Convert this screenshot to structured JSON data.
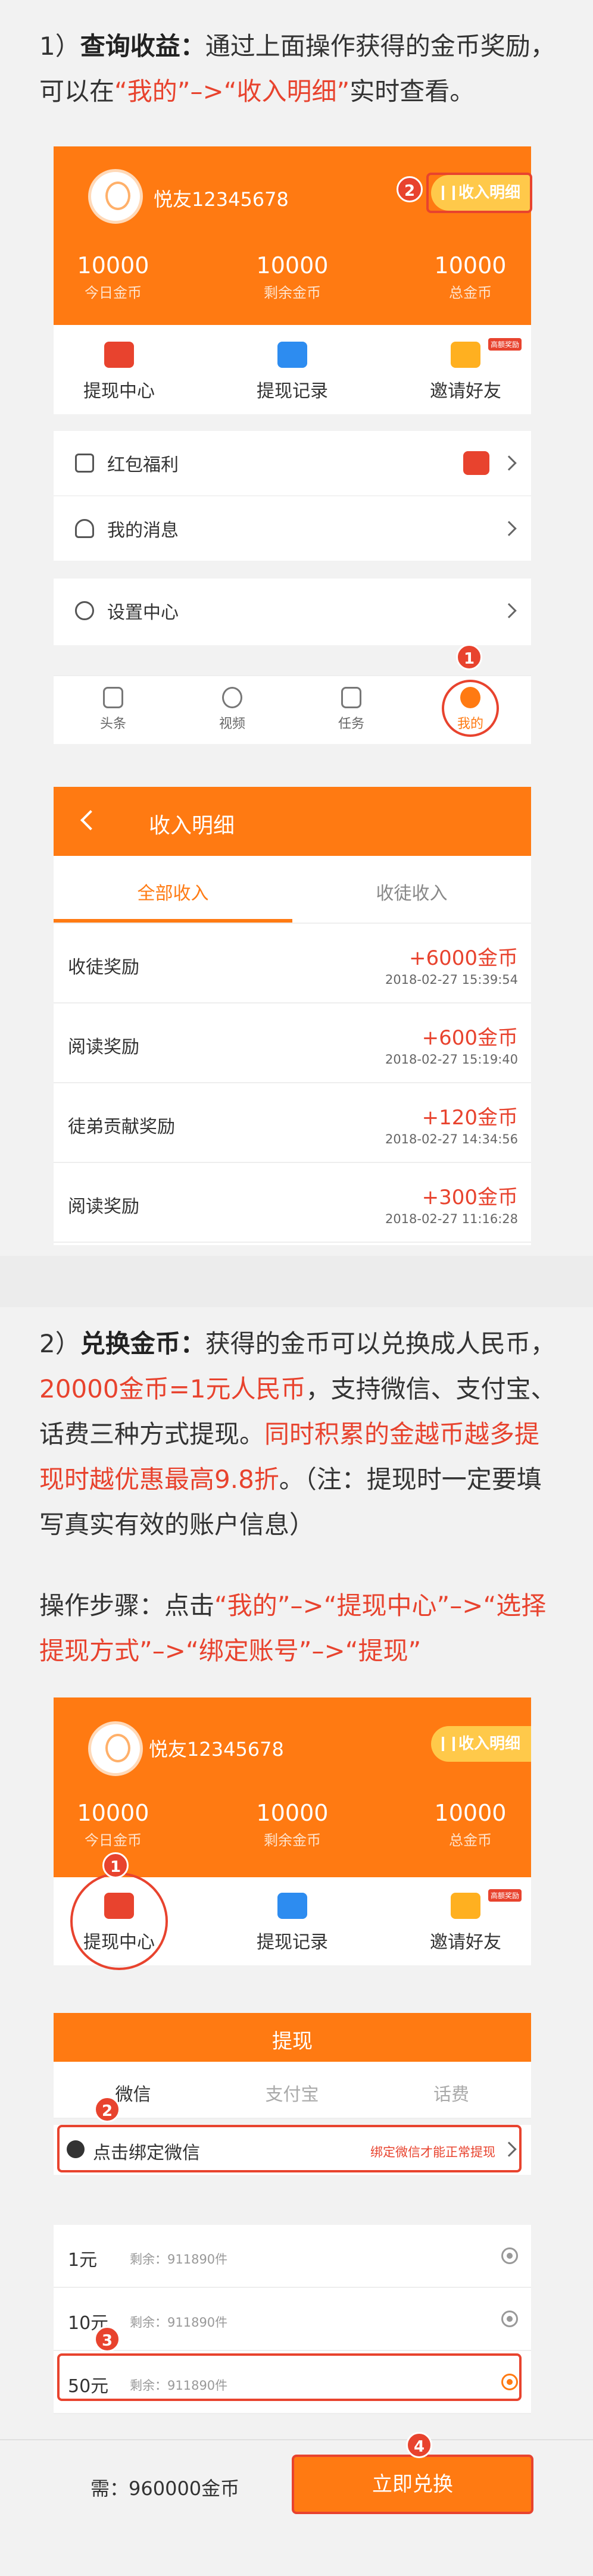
{
  "colors": {
    "accent": "#ff7a12",
    "highlight": "#e8432e",
    "text": "#333333"
  },
  "section1": {
    "index": "1）",
    "title": "查询收益：",
    "text_a": "通过上面操作获得的金币奖励，可以在",
    "link_me": "“我的”",
    "arrow": "–>",
    "link_income": "“收入明细”",
    "text_b": "实时查看。"
  },
  "profile": {
    "username": "悦友12345678",
    "income_button": "收入明细",
    "stats": [
      {
        "value": "10000",
        "label": "今日金币"
      },
      {
        "value": "10000",
        "label": "剩余金币"
      },
      {
        "value": "10000",
        "label": "总金币"
      }
    ],
    "shortcuts": [
      {
        "label": "提现中心",
        "icon": "wallet-icon"
      },
      {
        "label": "提现记录",
        "icon": "record-icon"
      },
      {
        "label": "邀请好友",
        "icon": "gift-icon",
        "tag": "高额奖励"
      }
    ],
    "menu": [
      {
        "label": "红包福利",
        "icon": "redpacket-icon"
      },
      {
        "label": "我的消息",
        "icon": "bell-icon"
      },
      {
        "label": "设置中心",
        "icon": "settings-icon"
      }
    ],
    "tabs": [
      {
        "label": "头条",
        "icon": "news-icon"
      },
      {
        "label": "视频",
        "icon": "video-icon"
      },
      {
        "label": "任务",
        "icon": "task-icon"
      },
      {
        "label": "我的",
        "icon": "me-icon"
      }
    ]
  },
  "steps": {
    "one": "1",
    "two": "2",
    "three": "3",
    "four": "4"
  },
  "income": {
    "title": "收入明细",
    "tab_all": "全部收入",
    "tab_apprentice": "收徒收入",
    "records": [
      {
        "name": "收徒奖励",
        "amount": "+6000金币",
        "time": "2018-02-27 15:39:54"
      },
      {
        "name": "阅读奖励",
        "amount": "+600金币",
        "time": "2018-02-27 15:19:40"
      },
      {
        "name": "徒弟贡献奖励",
        "amount": "+120金币",
        "time": "2018-02-27 14:34:56"
      },
      {
        "name": "阅读奖励",
        "amount": "+300金币",
        "time": "2018-02-27 11:16:28"
      }
    ]
  },
  "section2": {
    "index": "2）",
    "title": "兑换金币：",
    "text_a": "获得的金币可以兑换成人民币，",
    "rate": "20000金币=1元人民币",
    "text_b": "，支持微信、支付宝、话费三种方式提现。",
    "bonus": "同时积累的金越币越多提现时越优惠最高9.8折",
    "text_c": "。（注：提现时一定要填写真实有效的账户信息）",
    "steps_prefix": "操作步骤：点击",
    "steps_me": "“我的”",
    "steps_center": "“提现中心”",
    "steps_method": "“选择提现方式”",
    "steps_bind": "“绑定账号”",
    "steps_withdraw": "“提现”",
    "arrow": "–>"
  },
  "withdraw": {
    "title": "提现",
    "methods": [
      "微信",
      "支付宝",
      "话费"
    ],
    "bind_label": "点击绑定微信",
    "bind_hint": "绑定微信才能正常提现",
    "options": [
      {
        "value": "1元",
        "remain": "剩余：911890件",
        "selected": false
      },
      {
        "value": "10元",
        "remain": "剩余：911890件",
        "selected": false
      },
      {
        "value": "50元",
        "remain": "剩余：911890件",
        "selected": true
      }
    ],
    "need": "需：960000金币",
    "confirm": "立即兑换"
  }
}
